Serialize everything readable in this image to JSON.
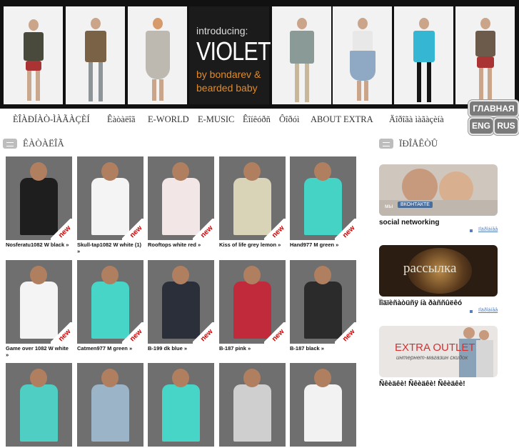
{
  "banner": {
    "intro": "introducing:",
    "brand": "VIOLET",
    "by_line_1": "by bondarev &",
    "by_line_2": "bearded baby"
  },
  "nav": {
    "items": [
      "ÈÎÀÐÍÀÒ-ÌÀÃÀÇÈÍ",
      "Êàòàëîã",
      "E-WORLD",
      "E-MUSIC",
      "Êîíêóðñ",
      "Ôîðóì",
      "ABOUT EXTRA",
      "Äîðîãà ìàãàçèíà"
    ]
  },
  "lang": {
    "main": "ГЛАВНАЯ",
    "eng": "ENG",
    "rus": "RUS"
  },
  "catalog": {
    "title": "ÊÀÒÀËÎÃ",
    "badge_text": "new",
    "products": [
      {
        "name": "Nosferatu1082 W black »",
        "shirt": "#1e1e1e"
      },
      {
        "name": "Skull-tap1082 W white (1) »",
        "shirt": "#f4f4f4"
      },
      {
        "name": "Rooftops white red »",
        "shirt": "#f3e6e6"
      },
      {
        "name": "Kiss of life grey lemon »",
        "shirt": "#d9d3b8"
      },
      {
        "name": "Hand977 M green »",
        "shirt": "#44d3c4"
      },
      {
        "name": "Game over 1082 W white »",
        "shirt": "#f4f4f4"
      },
      {
        "name": "Catmen977 M green »",
        "shirt": "#46d5c6"
      },
      {
        "name": "B-199 dk blue »",
        "shirt": "#2a2f3a"
      },
      {
        "name": "B-187 pink »",
        "shirt": "#c02a3b"
      },
      {
        "name": "B-187 black »",
        "shirt": "#2b2b2b"
      },
      {
        "name": "",
        "shirt": "#4fcfc3"
      },
      {
        "name": "",
        "shirt": "#9bb4c8"
      },
      {
        "name": "",
        "shirt": "#46d5c6"
      },
      {
        "name": "",
        "shirt": "#cfcfcf"
      },
      {
        "name": "",
        "shirt": "#f2f2f2"
      }
    ]
  },
  "sidebar": {
    "title": "ÏÐÎÅÊÒÛ",
    "cards": [
      {
        "caption": "social networking",
        "more": "ïîäðîáíåå",
        "overlay_1": "мы",
        "overlay_2": "ВКОНТАКТЕ"
      },
      {
        "caption": "Ïîäïèñàòüñÿ íà ðàññûëêó",
        "more": "ïîäðîáíåå",
        "overlay_1": "рассылка",
        "overlay_2": ""
      },
      {
        "caption": "Ñêèäêè! Ñêèäêè! Ñêèäêè!",
        "more": "",
        "overlay_1": "EXTRA OUTLET",
        "overlay_2": "интернет-магазин скидок"
      }
    ]
  },
  "colors": {
    "accent": "#e08a2a",
    "badge": "#d40000",
    "link": "#5a7fb8"
  }
}
